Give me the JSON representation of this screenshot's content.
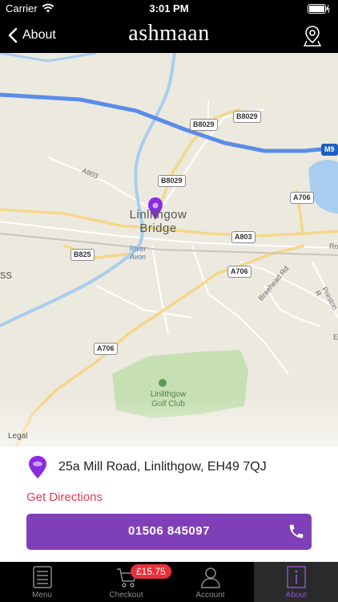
{
  "status_bar": {
    "carrier": "Carrier",
    "time": "3:01 PM"
  },
  "nav": {
    "back_label": "About",
    "brand": "ashmaan"
  },
  "map": {
    "town": "Linlithgow Bridge",
    "river": "River Avon",
    "golf": "Linlithgow Golf Club",
    "legal": "Legal",
    "roads": {
      "m9": "M9",
      "b8029_a": "B8029",
      "b8029_b": "B8029",
      "b8029_c": "B8029",
      "a706_a": "A706",
      "a706_b": "A706",
      "a706_c": "A706",
      "a803_badge": "A803",
      "b825": "B825"
    },
    "streets": {
      "a803_text": "A803",
      "braehead": "Braehead Rd",
      "preston": "Preston R",
      "edge_ro": "Ro",
      "edge_ss": "ss",
      "edge_e": "E"
    }
  },
  "location": {
    "address": "25a Mill Road, Linlithgow, EH49 7QJ",
    "directions_label": "Get Directions",
    "phone": "01506 845097"
  },
  "tabs": [
    {
      "label": "Menu",
      "icon": "menu-icon"
    },
    {
      "label": "Checkout",
      "icon": "cart-icon",
      "badge": "£15.75"
    },
    {
      "label": "Account",
      "icon": "account-icon"
    },
    {
      "label": "About",
      "icon": "info-icon",
      "active": true
    }
  ],
  "colors": {
    "brand_purple": "#7f3fb8",
    "directions_red": "#e03c52",
    "badge_red": "#e8303c",
    "route_blue": "#5b8de8"
  }
}
